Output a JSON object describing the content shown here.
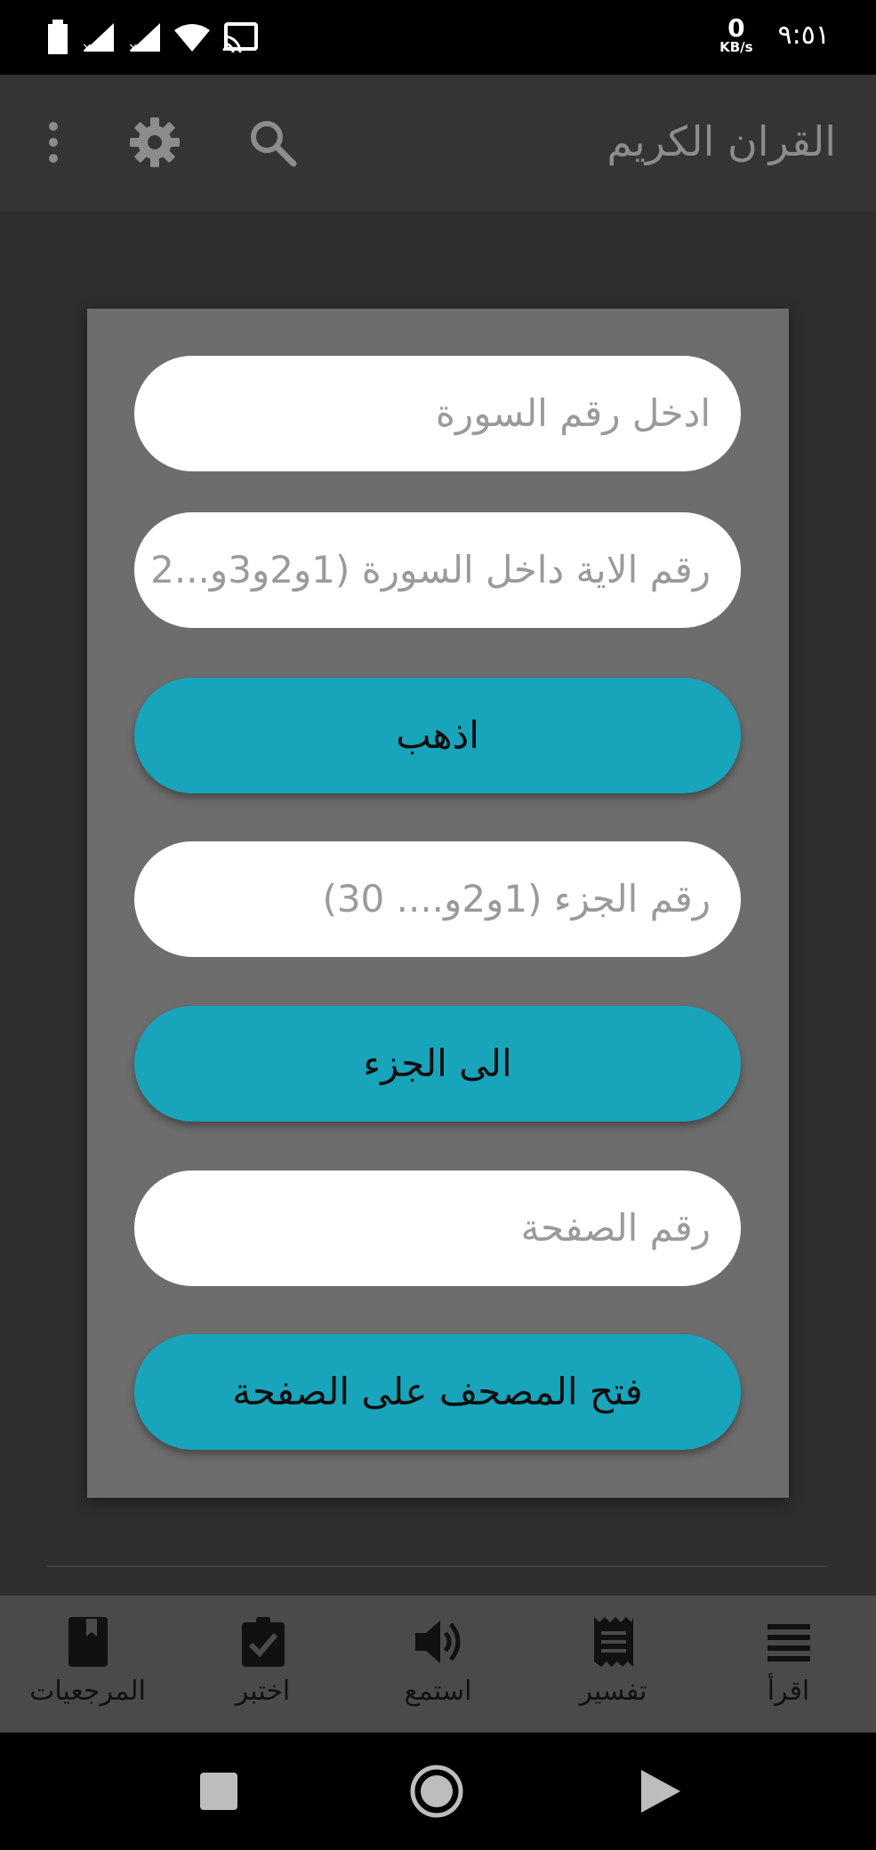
{
  "status_bar": {
    "net_speed_value": "0",
    "net_speed_unit": "KB/s",
    "clock": "٩:٥١"
  },
  "app_bar": {
    "title": "القران الكريم"
  },
  "dialog": {
    "surah_placeholder": "ادخل رقم السورة",
    "ayah_placeholder": "رقم الاية داخل السورة (1و2و3و...2",
    "go_button": "اذهب",
    "juz_placeholder": "رقم الجزء (1و2و.... 30)",
    "juz_button": "الى الجزء",
    "page_placeholder": "رقم الصفحة",
    "page_button": "فتح المصحف على الصفحة"
  },
  "bottom_nav": {
    "items": [
      {
        "label": "المرجعيات",
        "icon": "bookmark-book-icon"
      },
      {
        "label": "اختبر",
        "icon": "clipboard-check-icon"
      },
      {
        "label": "استمع",
        "icon": "speaker-icon"
      },
      {
        "label": "تفسير",
        "icon": "receipt-icon"
      },
      {
        "label": "اقرأ",
        "icon": "reading-lines-icon"
      }
    ]
  },
  "colors": {
    "accent": "#18a4ba",
    "dialog_bg": "#6e6d6e",
    "app_bar_bg": "#343434",
    "nav_bg": "#4a4a4a"
  }
}
